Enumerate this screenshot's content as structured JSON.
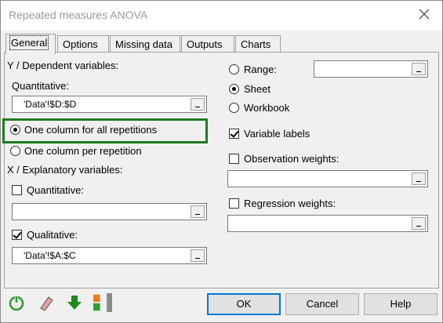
{
  "window": {
    "title": "Repeated measures ANOVA"
  },
  "tabs": [
    {
      "label": "General"
    },
    {
      "label": "Options"
    },
    {
      "label": "Missing data"
    },
    {
      "label": "Outputs"
    },
    {
      "label": "Charts"
    }
  ],
  "left": {
    "y_section": "Y / Dependent variables:",
    "quantitative_label": "Quantitative:",
    "quantitative_value": "'Data'!$D:$D",
    "radio_one_col": "One column for all repetitions",
    "radio_per_rep": "One column per repetition",
    "x_section": "X / Explanatory variables:",
    "x_quant_label": "Quantitative:",
    "x_quant_value": "",
    "x_qual_label": "Qualitative:",
    "x_qual_value": "'Data'!$A:$C"
  },
  "right": {
    "range_label": "Range:",
    "range_value": "",
    "sheet_label": "Sheet",
    "workbook_label": "Workbook",
    "variable_labels": "Variable labels",
    "obs_weights": "Observation weights:",
    "obs_weights_value": "",
    "reg_weights": "Regression weights:",
    "reg_weights_value": ""
  },
  "buttons": {
    "ok": "OK",
    "cancel": "Cancel",
    "help": "Help"
  },
  "colors": {
    "highlight": "#1f7a1f",
    "accent": "#0078d7"
  }
}
